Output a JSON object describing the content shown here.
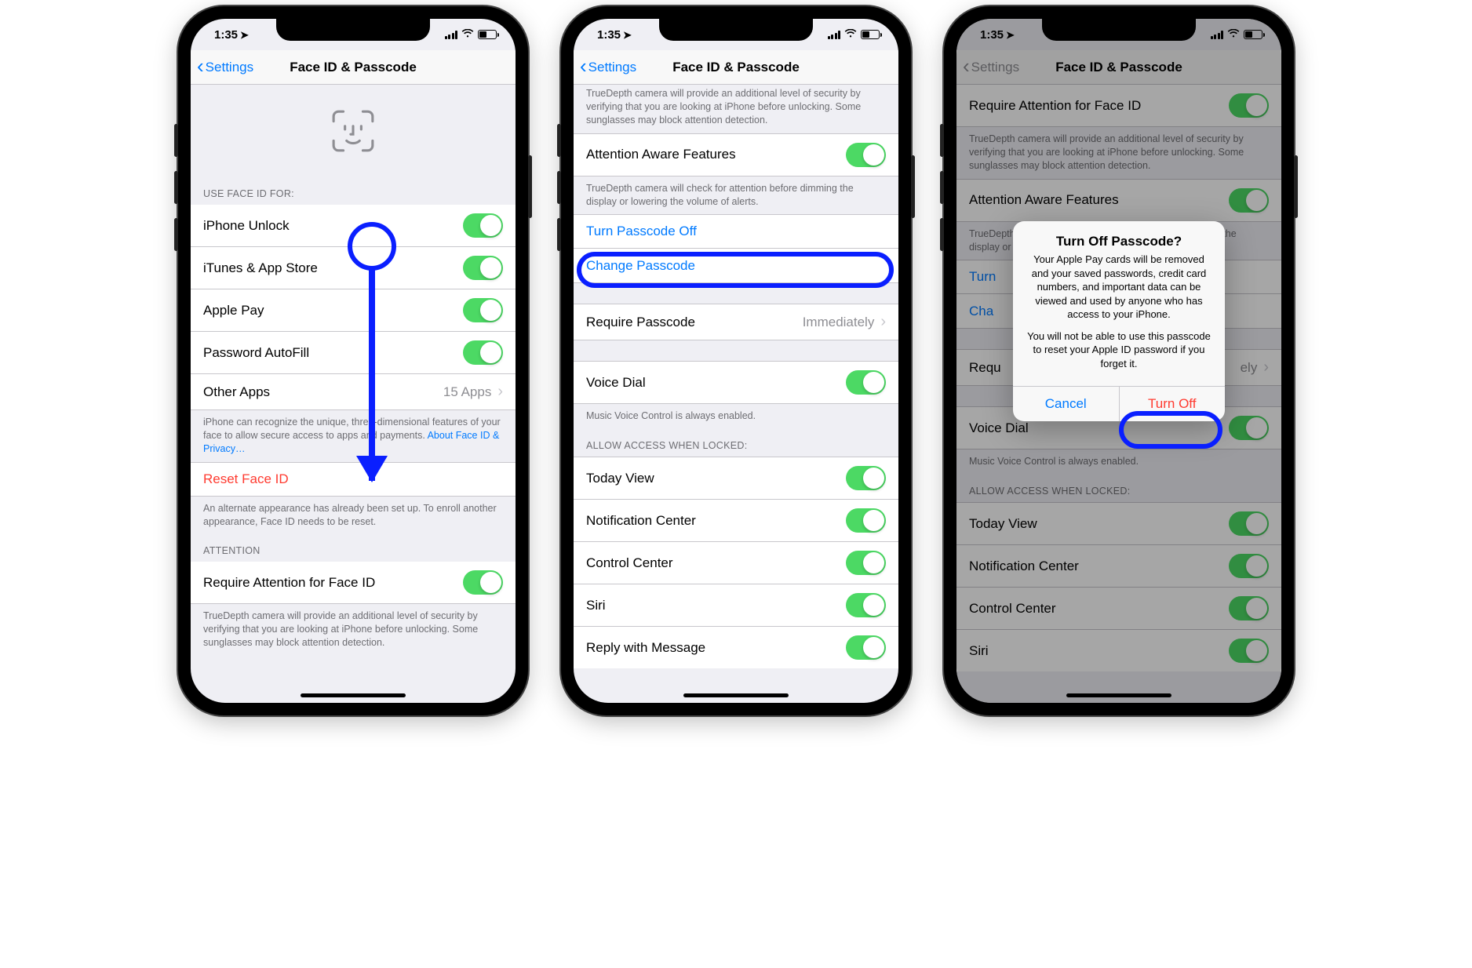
{
  "status": {
    "time": "1:35",
    "loc_glyph": "➤"
  },
  "nav": {
    "back": "Settings",
    "title": "Face ID & Passcode"
  },
  "screen1": {
    "header_useFaceID": "USE FACE ID FOR:",
    "rows": {
      "iphoneUnlock": "iPhone Unlock",
      "itunes": "iTunes & App Store",
      "applePay": "Apple Pay",
      "autofill": "Password AutoFill",
      "otherApps": "Other Apps",
      "otherAppsValue": "15 Apps"
    },
    "footer_useFaceID": "iPhone can recognize the unique, three-dimensional features of your face to allow secure access to apps and payments. ",
    "footer_link": "About Face ID & Privacy…",
    "resetFaceID": "Reset Face ID",
    "footer_reset": "An alternate appearance has already been set up. To enroll another appearance, Face ID needs to be reset.",
    "header_attention": "ATTENTION",
    "requireAttention": "Require Attention for Face ID",
    "footer_attention": "TrueDepth camera will provide an additional level of security by verifying that you are looking at iPhone before unlocking. Some sunglasses may block attention detection."
  },
  "screen2": {
    "footer_top_cut": "TrueDepth camera will provide an additional level of security by verifying that you are looking at iPhone before unlocking. Some sunglasses may block attention detection.",
    "attentionAware": "Attention Aware Features",
    "footer_attentionAware": "TrueDepth camera will check for attention before dimming the display or lowering the volume of alerts.",
    "turnOff": "Turn Passcode Off",
    "change": "Change Passcode",
    "require": "Require Passcode",
    "requireValue": "Immediately",
    "voiceDial": "Voice Dial",
    "footer_voiceDial": "Music Voice Control is always enabled.",
    "header_allow": "ALLOW ACCESS WHEN LOCKED:",
    "allowRows": [
      "Today View",
      "Notification Center",
      "Control Center",
      "Siri",
      "Reply with Message"
    ]
  },
  "screen3": {
    "requireAttention": "Require Attention for Face ID",
    "cut_value_left": "Turn",
    "cut_value_left2": "Cha",
    "requirePasscode_left": "Requ",
    "requirePasscode_right": "ely",
    "alert": {
      "title": "Turn Off Passcode?",
      "msg1": "Your Apple Pay cards will be removed and your saved passwords, credit card numbers, and important data can be viewed and used by anyone who has access to your iPhone.",
      "msg2": "You will not be able to use this passcode to reset your Apple ID password if you forget it.",
      "cancel": "Cancel",
      "turnOff": "Turn Off"
    }
  }
}
